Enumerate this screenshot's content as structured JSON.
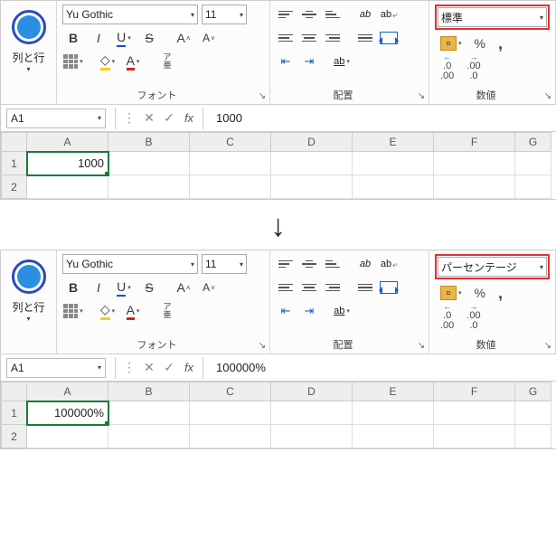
{
  "top": {
    "row_col_label": "列と行",
    "font_name": "Yu Gothic",
    "font_size": "11",
    "font_section_label": "フォント",
    "align_section_label": "配置",
    "num_section_label": "数値",
    "num_format": "標準",
    "percent_sym": "%",
    "comma_sym": ",",
    "furigana": "ア\n亜",
    "inc_dec_1": ".0",
    "inc_dec_2": ".00",
    "ab": "ab",
    "fx": "fx",
    "name_box": "A1",
    "formula": "1000",
    "cols": [
      "A",
      "B",
      "C",
      "D",
      "E",
      "F",
      "G"
    ],
    "rows": [
      "1",
      "2"
    ],
    "cell_a1": "1000"
  },
  "bottom": {
    "row_col_label": "列と行",
    "font_name": "Yu Gothic",
    "font_size": "11",
    "font_section_label": "フォント",
    "align_section_label": "配置",
    "num_section_label": "数値",
    "num_format": "パーセンテージ",
    "percent_sym": "%",
    "comma_sym": ",",
    "furigana": "ア\n亜",
    "inc_dec_1": ".0",
    "inc_dec_2": ".00",
    "ab": "ab",
    "fx": "fx",
    "name_box": "A1",
    "formula": "100000%",
    "cols": [
      "A",
      "B",
      "C",
      "D",
      "E",
      "F",
      "G"
    ],
    "rows": [
      "1",
      "2"
    ],
    "cell_a1": "100000%"
  }
}
